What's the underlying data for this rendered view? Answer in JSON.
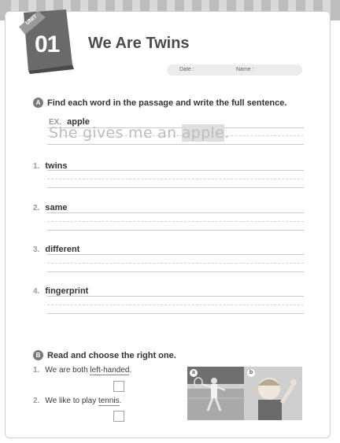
{
  "unit": {
    "label": "UNIT",
    "number": "01"
  },
  "title": "We Are Twins",
  "meta": {
    "date_label": "Date :",
    "name_label": "Name :"
  },
  "section_a": {
    "badge": "A",
    "instruction": "Find each word in the passage and write the full sentence.",
    "example": {
      "label": "EX.",
      "word": "apple",
      "sentence_before": "She gives me an ",
      "sentence_highlight": "apple",
      "sentence_after": "."
    },
    "items": [
      {
        "num": "1.",
        "word": "twins"
      },
      {
        "num": "2.",
        "word": "same"
      },
      {
        "num": "3.",
        "word": "different"
      },
      {
        "num": "4.",
        "word": "fingerprint"
      }
    ]
  },
  "section_b": {
    "badge": "B",
    "instruction": "Read and choose the right one.",
    "items": [
      {
        "num": "1.",
        "text_before": "We are both ",
        "underlined": "left-handed",
        "text_after": "."
      },
      {
        "num": "2.",
        "text_before": "We like to play ",
        "underlined": "tennis",
        "text_after": "."
      }
    ],
    "photo_labels": [
      "a",
      "b"
    ]
  },
  "colors": {
    "ink": "#3a3a3a",
    "gray_band": "#bdbdbd",
    "trace": "#bdbdbd"
  }
}
